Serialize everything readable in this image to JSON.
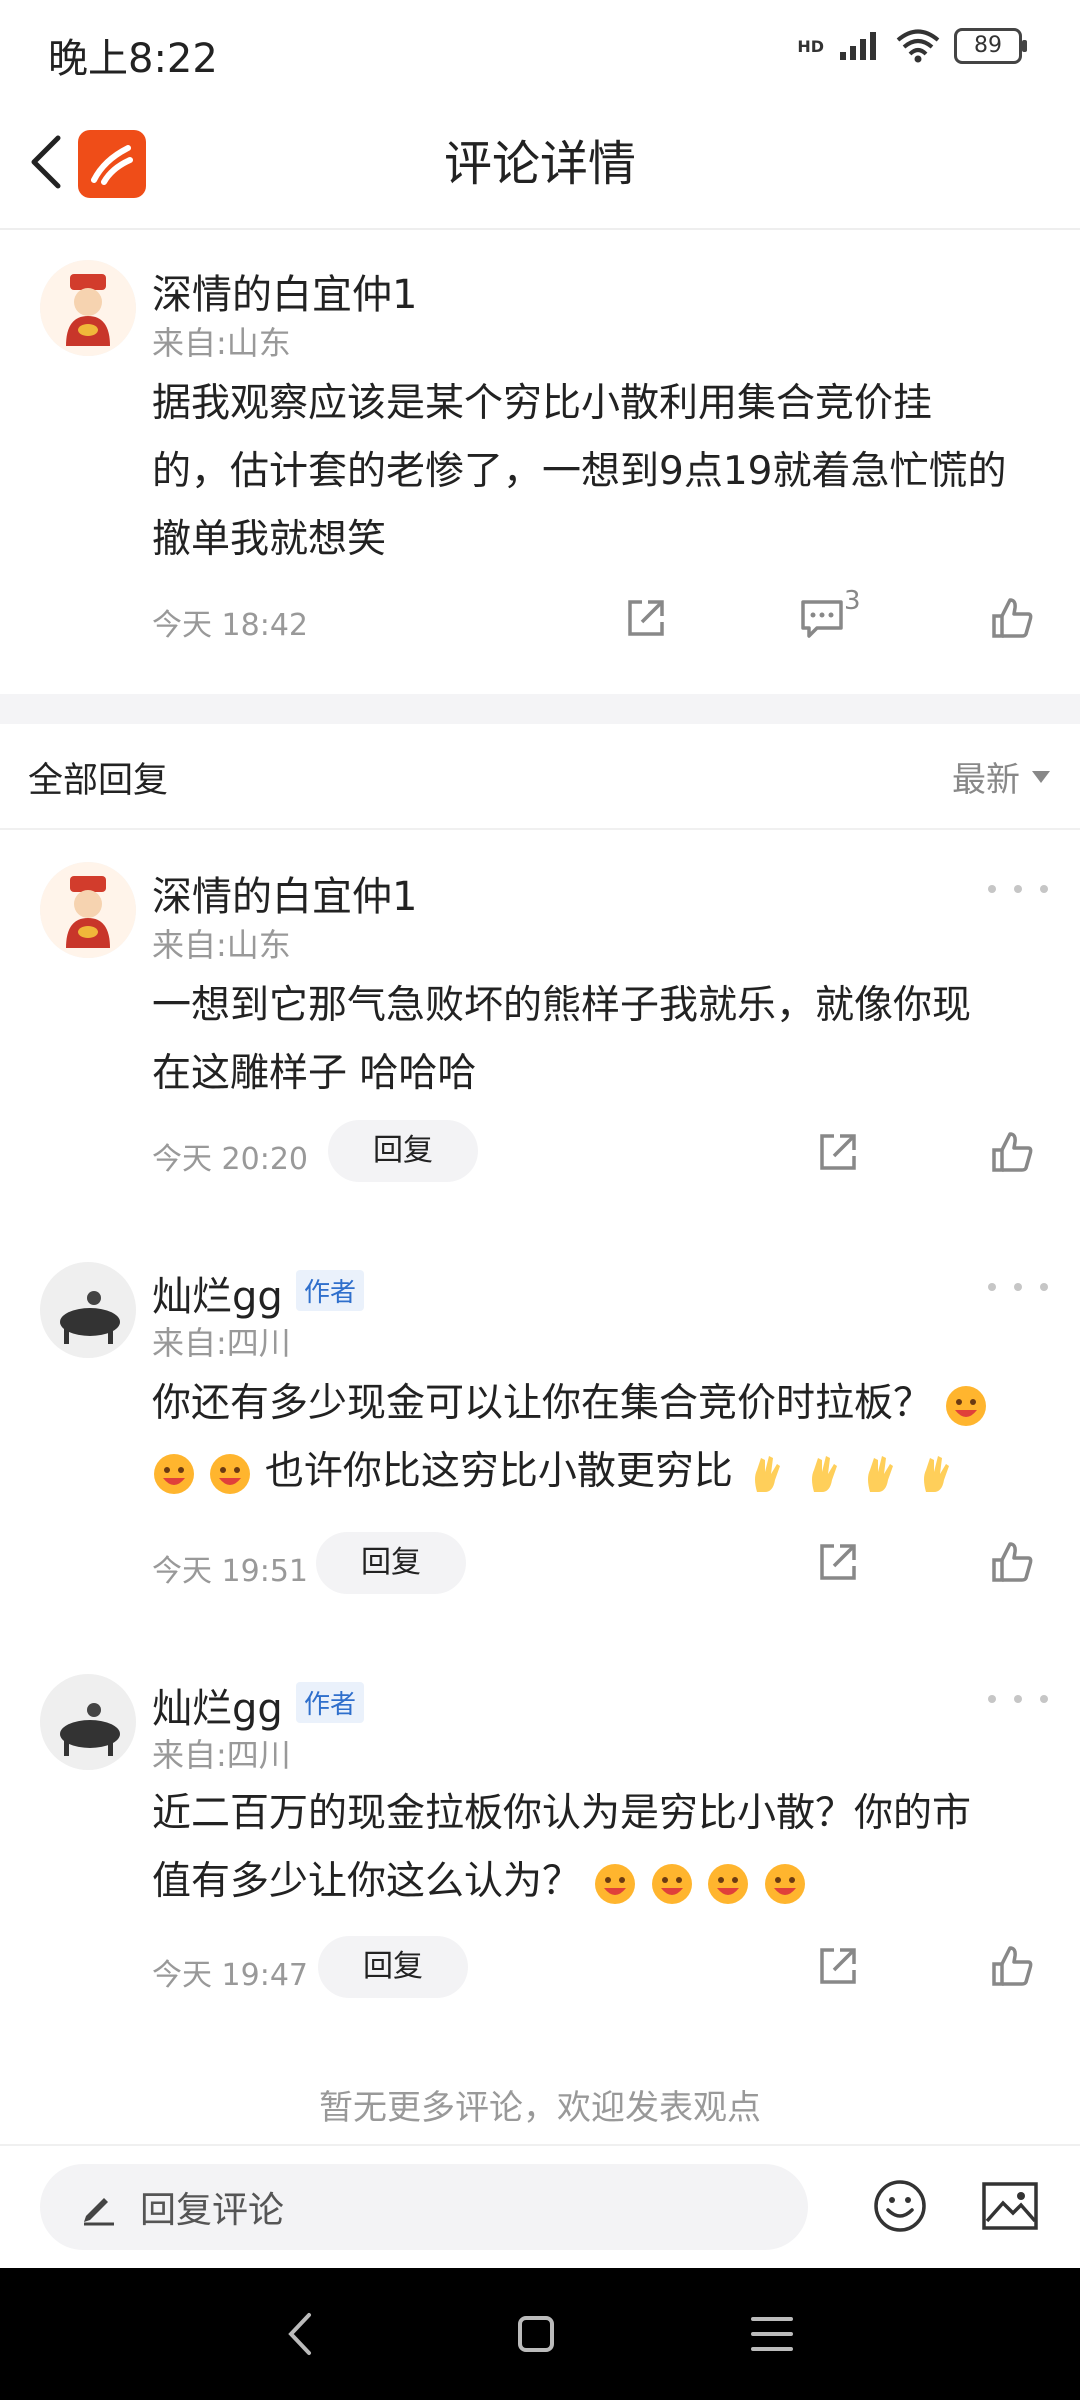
{
  "status_bar": {
    "time": "晚上8:22",
    "battery": "89",
    "network": "HD"
  },
  "header": {
    "title": "评论详情"
  },
  "main_comment": {
    "username": "深情的白宜仲1",
    "location": "来自:山东",
    "content_lines": [
      "据我观察应该是某个穷比小散利用集合竞价挂",
      "的，估计套的老惨了，一想到9点19就着急忙慌的",
      "撤单我就想笑"
    ],
    "time": "今天 18:42",
    "reply_count": "3"
  },
  "replies_section": {
    "title": "全部回复",
    "sort": "最新"
  },
  "replies": [
    {
      "username": "深情的白宜仲1",
      "location": "来自:山东",
      "content_lines": [
        "一想到它那气急败坏的熊样子我就乐，就像你现",
        "在这雕样子 哈哈哈"
      ],
      "time": "今天 20:20",
      "reply_label": "回复"
    },
    {
      "username": "灿烂gg",
      "badge": "作者",
      "location": "来自:四川",
      "content_line1": "你还有多少现金可以让你在集合竞价时拉板？",
      "content_line2": "也许你比这穷比小散更穷比",
      "time": "今天 19:51",
      "reply_label": "回复"
    },
    {
      "username": "灿烂gg",
      "badge": "作者",
      "location": "来自:四川",
      "content_line1": "近二百万的现金拉板你认为是穷比小散？你的市",
      "content_line2": "值有多少让你这么认为？",
      "time": "今天 19:47",
      "reply_label": "回复"
    }
  ],
  "footer_note": "暂无更多评论，欢迎发表观点",
  "input_bar": {
    "placeholder": "回复评论"
  },
  "colors": {
    "brand": "#ef4d18",
    "author_badge": "#2f6fcc"
  }
}
